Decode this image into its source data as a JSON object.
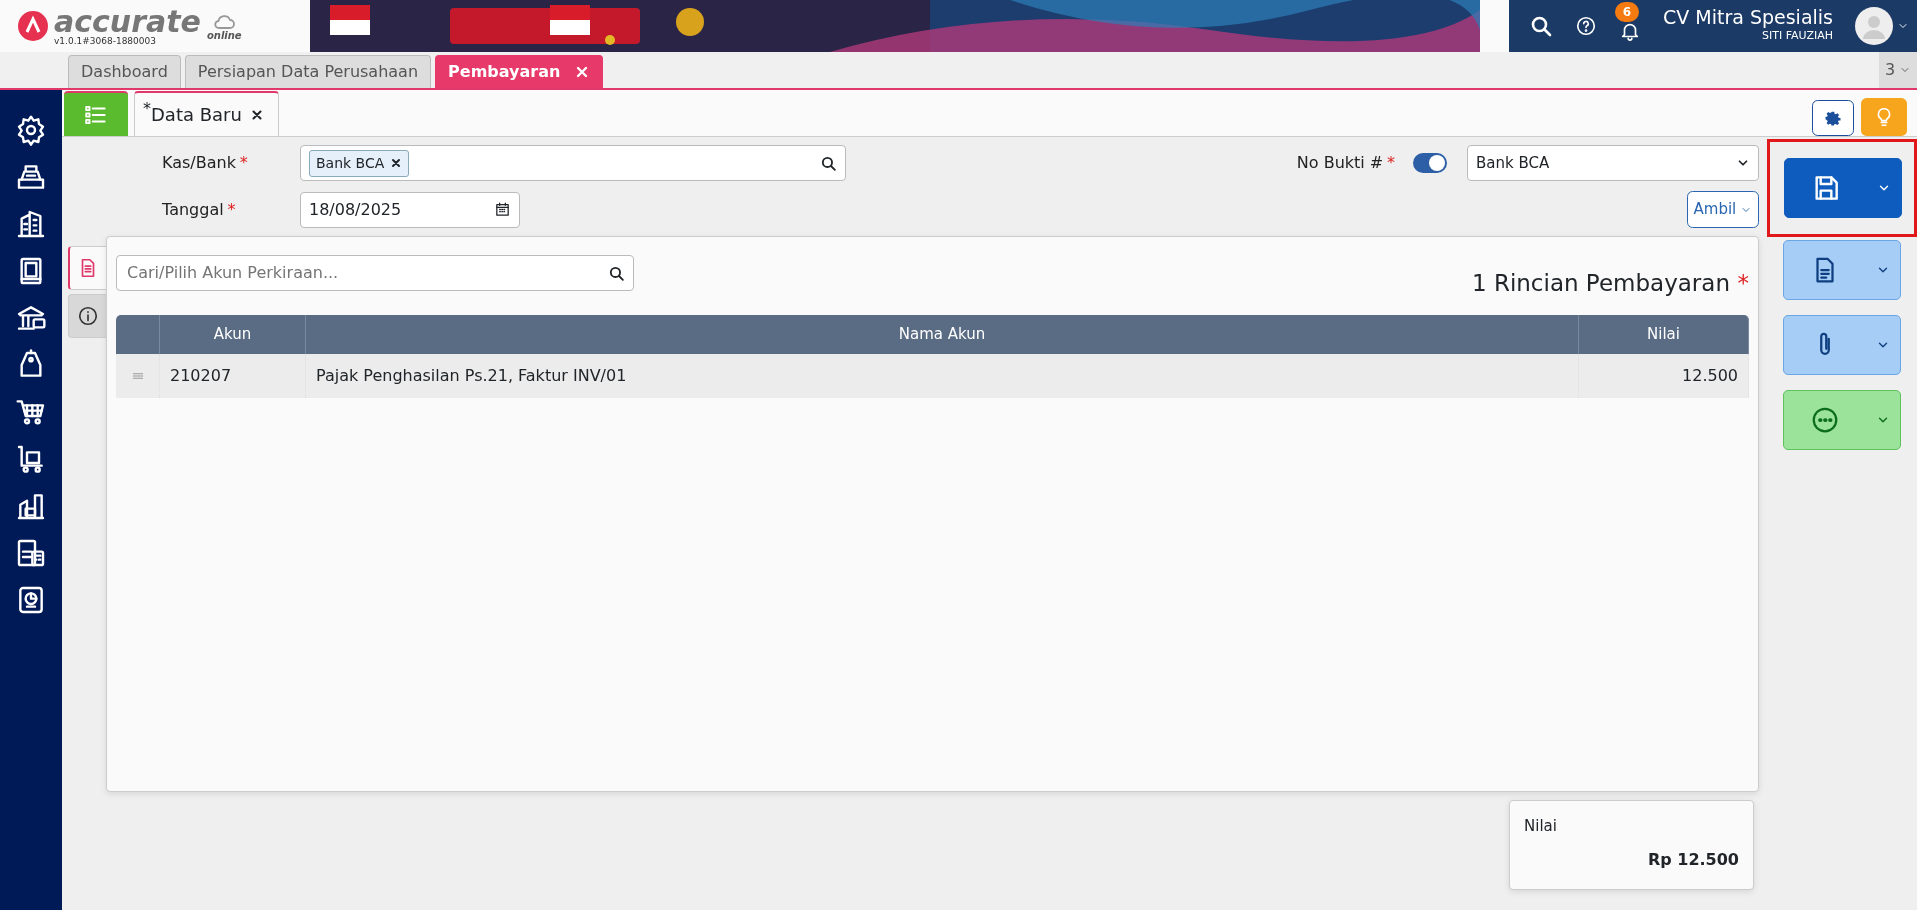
{
  "header": {
    "logo": "accurate",
    "logo_sub": "online",
    "version": "v1.0.1#3068-1880003",
    "notifications": "6",
    "company": "CV Mitra Spesialis",
    "user": "SITI FAUZIAH"
  },
  "tabs": [
    {
      "label": "Dashboard",
      "selected": false,
      "closable": false
    },
    {
      "label": "Persiapan Data Perusahaan",
      "selected": false,
      "closable": false
    },
    {
      "label": "Pembayaran",
      "selected": true,
      "closable": true
    }
  ],
  "tab_count": "3",
  "doc_tabs": [
    {
      "prefix": "*",
      "label": "Data Baru",
      "selected": true
    }
  ],
  "form": {
    "kas_bank": {
      "label": "Kas/Bank",
      "required_mark": "*",
      "tag": "Bank BCA"
    },
    "tanggal": {
      "label": "Tanggal",
      "required_mark": "*",
      "value": "18/08/2025"
    },
    "no_bukti": {
      "label": "No Bukti #",
      "required_mark": "*",
      "auto": true,
      "value": "Bank BCA"
    },
    "ambil_button": "Ambil"
  },
  "side_tabs": [
    {
      "selected": true
    },
    {
      "selected": false
    }
  ],
  "detail": {
    "search_placeholder": "Cari/Pilih Akun Perkiraan...",
    "title": "1 Rincian Pembayaran",
    "title_mark": "*",
    "columns": [
      "Akun",
      "Nama Akun",
      "Nilai"
    ],
    "rows": [
      [
        "210207",
        "Pajak Penghasilan Ps.21, Faktur INV/01",
        "12.500"
      ]
    ]
  },
  "actions": {
    "save_highlighted": true
  },
  "total": {
    "label": "Nilai",
    "value": "Rp 12.500"
  }
}
